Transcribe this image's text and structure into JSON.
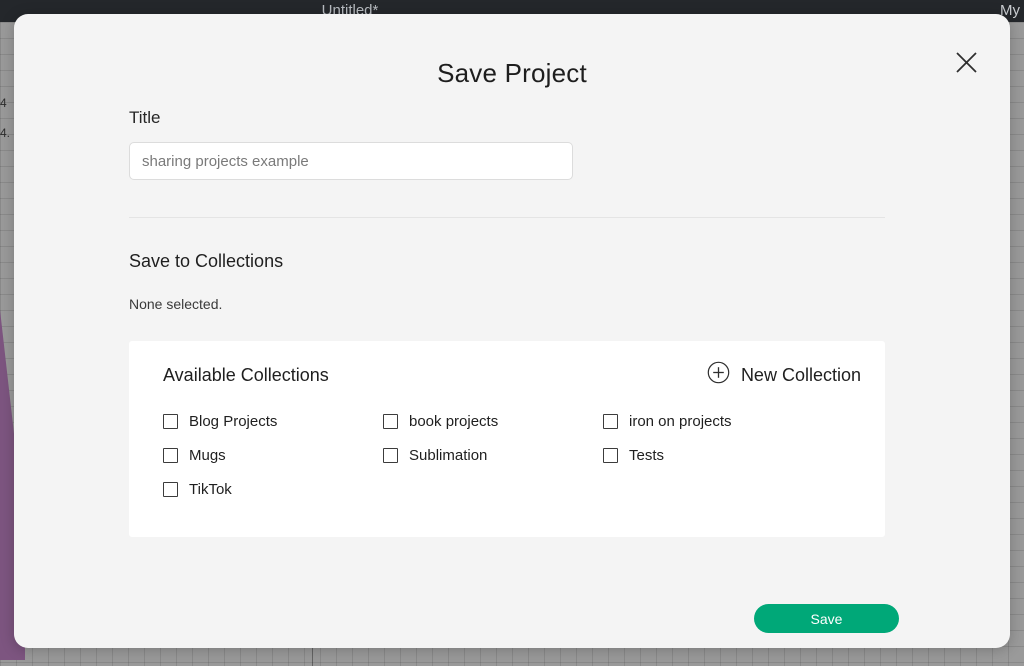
{
  "background_app": {
    "document_title": "Untitled*",
    "right_menu_label": "My",
    "ruler_labels": [
      "4",
      "4."
    ],
    "canvas_shape_color": "#7d5580"
  },
  "modal": {
    "title": "Save Project",
    "close_icon": "close-icon",
    "title_field": {
      "label": "Title",
      "value": "",
      "placeholder": "sharing projects example"
    },
    "collections_section": {
      "heading": "Save to Collections",
      "selection_status": "None selected."
    },
    "available_panel": {
      "heading": "Available Collections",
      "new_collection": {
        "label": "New Collection",
        "icon": "plus-circle-icon"
      },
      "items": [
        {
          "label": "Blog Projects",
          "checked": false
        },
        {
          "label": "book projects",
          "checked": false
        },
        {
          "label": "iron on projects",
          "checked": false
        },
        {
          "label": "Mugs",
          "checked": false
        },
        {
          "label": "Sublimation",
          "checked": false
        },
        {
          "label": "Tests",
          "checked": false
        },
        {
          "label": "TikTok",
          "checked": false
        }
      ]
    },
    "save_button": {
      "label": "Save",
      "color": "#00a878"
    }
  }
}
